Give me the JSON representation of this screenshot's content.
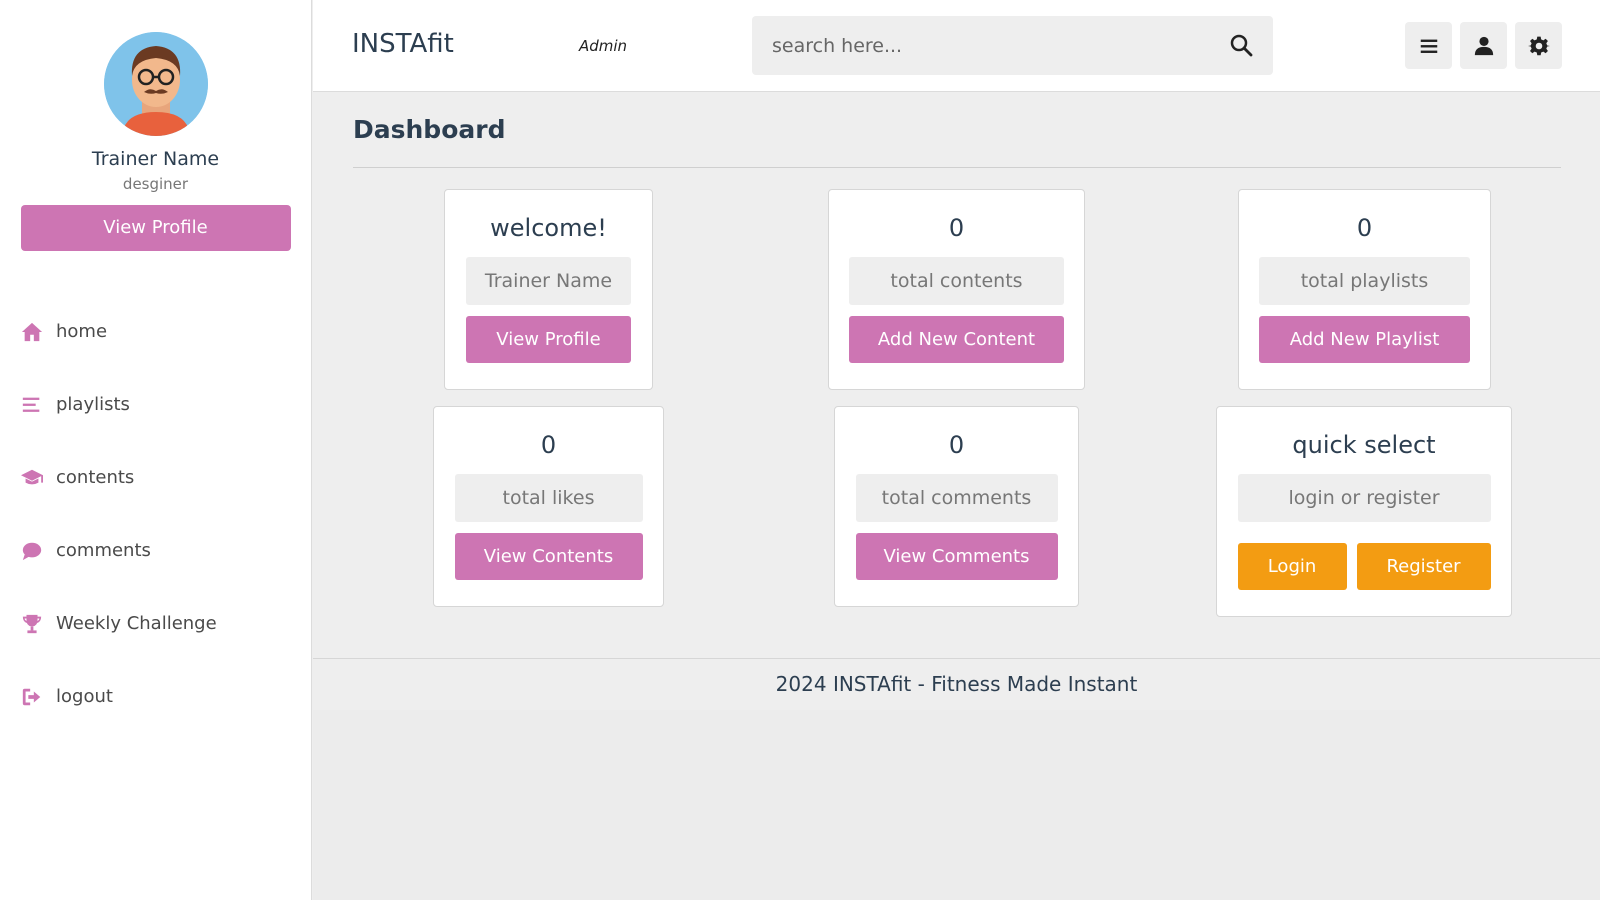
{
  "sidebar": {
    "profile": {
      "name": "Trainer Name",
      "role": "desginer",
      "view_profile_label": "View Profile"
    },
    "nav": [
      {
        "label": "home",
        "icon": "home-icon"
      },
      {
        "label": "playlists",
        "icon": "list-icon"
      },
      {
        "label": "contents",
        "icon": "graduation-cap-icon"
      },
      {
        "label": "comments",
        "icon": "comment-icon"
      },
      {
        "label": "Weekly Challenge",
        "icon": "trophy-icon"
      },
      {
        "label": "logout",
        "icon": "logout-icon"
      }
    ]
  },
  "header": {
    "brand": "INSTAfit",
    "role_tag": "Admin",
    "search_placeholder": "search here...",
    "icons": [
      "menu-icon",
      "user-icon",
      "settings-icon"
    ]
  },
  "main": {
    "title": "Dashboard",
    "cards": [
      {
        "heading": "welcome!",
        "box": "Trainer Name",
        "button": "View Profile"
      },
      {
        "heading": "0",
        "box": "total contents",
        "button": "Add New Content"
      },
      {
        "heading": "0",
        "box": "total playlists",
        "button": "Add New Playlist"
      },
      {
        "heading": "0",
        "box": "total likes",
        "button": "View Contents"
      },
      {
        "heading": "0",
        "box": "total comments",
        "button": "View Comments"
      },
      {
        "heading": "quick select",
        "box": "login or register",
        "login": "Login",
        "register": "Register"
      }
    ]
  },
  "footer": {
    "year": "2024",
    "brand": "INSTAfit",
    "tagline": "- Fitness Made Instant"
  },
  "colors": {
    "accent": "#cd75b3",
    "orange": "#f39c12",
    "background": "#eeeeee"
  }
}
